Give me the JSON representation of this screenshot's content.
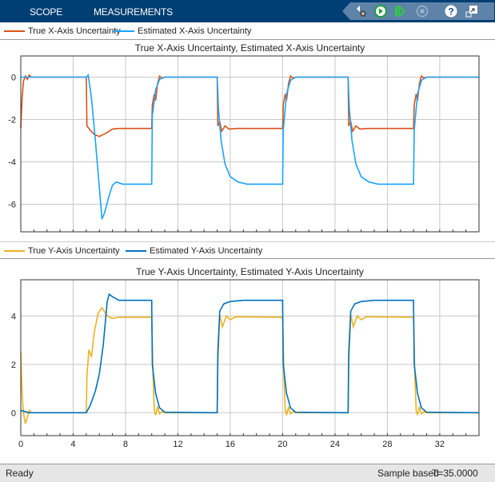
{
  "toolbar": {
    "tabs": [
      "SCOPE",
      "MEASUREMENTS"
    ],
    "icons": [
      "settings-icon",
      "run-icon",
      "step-forward-icon",
      "stop-icon",
      "help-icon",
      "undock-icon"
    ]
  },
  "colors": {
    "true_x": "#d95319",
    "est_x": "#1aa3ff",
    "true_y": "#edb120",
    "est_y": "#0072bd"
  },
  "chart_data": [
    {
      "type": "line",
      "title": "True X-Axis Uncertainty, Estimated X-Axis Uncertainty",
      "xlim": [
        0,
        35
      ],
      "ylim": [
        -7.3,
        1
      ],
      "yticks": [
        0,
        -2,
        -4,
        -6
      ],
      "xticks": [
        0,
        4,
        8,
        12,
        16,
        20,
        24,
        28,
        32
      ],
      "grid": true,
      "show_xticklabels": false,
      "series": [
        {
          "name": "True X-Axis Uncertainty",
          "color": "#d95319",
          "points": [
            [
              0,
              -2.4
            ],
            [
              0.1,
              -1
            ],
            [
              0.2,
              -0.2
            ],
            [
              0.35,
              0.05
            ],
            [
              0.5,
              -0.1
            ],
            [
              0.65,
              0.1
            ],
            [
              0.8,
              0
            ],
            [
              5,
              0
            ],
            [
              5.05,
              -2.3
            ],
            [
              5.3,
              -2.5
            ],
            [
              5.6,
              -2.7
            ],
            [
              6,
              -2.8
            ],
            [
              6.5,
              -2.65
            ],
            [
              7,
              -2.45
            ],
            [
              7.5,
              -2.42
            ],
            [
              10,
              -2.42
            ],
            [
              10.05,
              -1.3
            ],
            [
              10.2,
              -0.8
            ],
            [
              10.3,
              -1.1
            ],
            [
              10.45,
              -0.3
            ],
            [
              10.6,
              0.05
            ],
            [
              10.8,
              -0.05
            ],
            [
              11,
              0
            ],
            [
              15,
              0
            ],
            [
              15.05,
              -2.3
            ],
            [
              15.2,
              -2.1
            ],
            [
              15.35,
              -2.55
            ],
            [
              15.6,
              -2.3
            ],
            [
              15.9,
              -2.45
            ],
            [
              16.5,
              -2.42
            ],
            [
              20,
              -2.42
            ],
            [
              20.05,
              -1.3
            ],
            [
              20.2,
              -0.8
            ],
            [
              20.3,
              -1.1
            ],
            [
              20.45,
              -0.3
            ],
            [
              20.6,
              0.05
            ],
            [
              20.8,
              -0.05
            ],
            [
              21,
              0
            ],
            [
              25,
              0
            ],
            [
              25.05,
              -2.3
            ],
            [
              25.2,
              -2.1
            ],
            [
              25.35,
              -2.55
            ],
            [
              25.6,
              -2.3
            ],
            [
              25.9,
              -2.45
            ],
            [
              26.5,
              -2.42
            ],
            [
              30,
              -2.42
            ],
            [
              30.05,
              -1.3
            ],
            [
              30.2,
              -0.8
            ],
            [
              30.3,
              -1.1
            ],
            [
              30.45,
              -0.3
            ],
            [
              30.6,
              0.05
            ],
            [
              30.8,
              -0.05
            ],
            [
              31,
              0
            ],
            [
              35,
              0
            ]
          ]
        },
        {
          "name": "Estimated X-Axis Uncertainty",
          "color": "#1aa3ff",
          "points": [
            [
              0,
              0
            ],
            [
              0.3,
              0
            ],
            [
              5,
              0
            ],
            [
              5.15,
              0.1
            ],
            [
              5.4,
              -1
            ],
            [
              5.7,
              -3
            ],
            [
              6,
              -5.2
            ],
            [
              6.2,
              -6.7
            ],
            [
              6.4,
              -6.4
            ],
            [
              6.7,
              -5.7
            ],
            [
              7,
              -5.1
            ],
            [
              7.3,
              -4.95
            ],
            [
              7.8,
              -5.05
            ],
            [
              10,
              -5.05
            ],
            [
              10.05,
              -1.8
            ],
            [
              10.3,
              -0.6
            ],
            [
              10.6,
              -0.1
            ],
            [
              11,
              0
            ],
            [
              15,
              0
            ],
            [
              15.1,
              -1.5
            ],
            [
              15.3,
              -3
            ],
            [
              15.6,
              -4.1
            ],
            [
              16,
              -4.7
            ],
            [
              16.6,
              -4.95
            ],
            [
              17.3,
              -5.05
            ],
            [
              20,
              -5.05
            ],
            [
              20.05,
              -2.5
            ],
            [
              20.3,
              -0.8
            ],
            [
              20.6,
              -0.15
            ],
            [
              21,
              0
            ],
            [
              25,
              0
            ],
            [
              25.1,
              -1.5
            ],
            [
              25.3,
              -3
            ],
            [
              25.6,
              -4.1
            ],
            [
              26,
              -4.7
            ],
            [
              26.6,
              -4.95
            ],
            [
              27.3,
              -5.05
            ],
            [
              30,
              -5.05
            ],
            [
              30.05,
              -2.5
            ],
            [
              30.3,
              -0.8
            ],
            [
              30.6,
              -0.15
            ],
            [
              31,
              0
            ],
            [
              35,
              0
            ]
          ]
        }
      ]
    },
    {
      "type": "line",
      "title": "True Y-Axis Uncertainty, Estimated Y-Axis Uncertainty",
      "xlim": [
        0,
        35
      ],
      "ylim": [
        -0.95,
        5.5
      ],
      "yticks": [
        0,
        2,
        4
      ],
      "xticks": [
        0,
        4,
        8,
        12,
        16,
        20,
        24,
        28,
        32
      ],
      "xticklabels": [
        "0",
        "4",
        "8",
        "12",
        "16",
        "20",
        "24",
        "28",
        "32"
      ],
      "grid": true,
      "series": [
        {
          "name": "True Y-Axis Uncertainty",
          "color": "#edb120",
          "points": [
            [
              0,
              2.5
            ],
            [
              0.1,
              0.8
            ],
            [
              0.2,
              0
            ],
            [
              0.35,
              -0.45
            ],
            [
              0.5,
              -0.2
            ],
            [
              0.65,
              0.1
            ],
            [
              0.8,
              0
            ],
            [
              5,
              0
            ],
            [
              5.05,
              1.5
            ],
            [
              5.2,
              2.6
            ],
            [
              5.4,
              2.3
            ],
            [
              5.6,
              3.3
            ],
            [
              5.9,
              4.1
            ],
            [
              6.2,
              4.35
            ],
            [
              6.6,
              4
            ],
            [
              7,
              3.9
            ],
            [
              7.5,
              3.95
            ],
            [
              10,
              3.95
            ],
            [
              10.1,
              1.5
            ],
            [
              10.2,
              0.1
            ],
            [
              10.3,
              -0.1
            ],
            [
              10.45,
              0.25
            ],
            [
              10.6,
              -0.05
            ],
            [
              10.8,
              0.05
            ],
            [
              11,
              0
            ],
            [
              15,
              0
            ],
            [
              15.05,
              2
            ],
            [
              15.2,
              4.05
            ],
            [
              15.4,
              3.55
            ],
            [
              15.7,
              4
            ],
            [
              16,
              3.85
            ],
            [
              16.4,
              3.97
            ],
            [
              20,
              3.95
            ],
            [
              20.1,
              1.5
            ],
            [
              20.2,
              0.1
            ],
            [
              20.3,
              -0.1
            ],
            [
              20.45,
              0.25
            ],
            [
              20.6,
              -0.05
            ],
            [
              20.8,
              0.05
            ],
            [
              21,
              0
            ],
            [
              25,
              0
            ],
            [
              25.05,
              2
            ],
            [
              25.2,
              4.05
            ],
            [
              25.4,
              3.55
            ],
            [
              25.7,
              4
            ],
            [
              26,
              3.85
            ],
            [
              26.4,
              3.97
            ],
            [
              30,
              3.95
            ],
            [
              30.1,
              1.5
            ],
            [
              30.2,
              0.1
            ],
            [
              30.3,
              -0.1
            ],
            [
              30.45,
              0.25
            ],
            [
              30.6,
              -0.05
            ],
            [
              30.8,
              0.05
            ],
            [
              31,
              0
            ],
            [
              35,
              0
            ]
          ]
        },
        {
          "name": "Estimated Y-Axis Uncertainty",
          "color": "#0072bd",
          "points": [
            [
              0,
              0.1
            ],
            [
              0.3,
              0.05
            ],
            [
              0.6,
              0
            ],
            [
              5,
              0
            ],
            [
              5.3,
              0.3
            ],
            [
              5.7,
              0.9
            ],
            [
              6,
              1.6
            ],
            [
              6.3,
              2.8
            ],
            [
              6.6,
              4.6
            ],
            [
              6.75,
              4.9
            ],
            [
              7,
              4.8
            ],
            [
              7.5,
              4.65
            ],
            [
              10,
              4.65
            ],
            [
              10.05,
              2
            ],
            [
              10.3,
              0.8
            ],
            [
              10.6,
              0.2
            ],
            [
              11,
              0.02
            ],
            [
              15,
              0
            ],
            [
              15.05,
              2.5
            ],
            [
              15.2,
              4.2
            ],
            [
              15.5,
              4.5
            ],
            [
              16,
              4.6
            ],
            [
              17,
              4.65
            ],
            [
              20,
              4.65
            ],
            [
              20.05,
              2
            ],
            [
              20.3,
              0.8
            ],
            [
              20.6,
              0.2
            ],
            [
              21,
              0.02
            ],
            [
              25,
              0
            ],
            [
              25.05,
              2.5
            ],
            [
              25.2,
              4.2
            ],
            [
              25.5,
              4.5
            ],
            [
              26,
              4.6
            ],
            [
              27,
              4.65
            ],
            [
              30,
              4.65
            ],
            [
              30.05,
              2
            ],
            [
              30.3,
              0.8
            ],
            [
              30.6,
              0.2
            ],
            [
              31,
              0.02
            ],
            [
              35,
              0
            ]
          ]
        }
      ]
    }
  ],
  "status": {
    "left": "Ready",
    "mode": "Sample based",
    "time": "T=35.0000"
  }
}
